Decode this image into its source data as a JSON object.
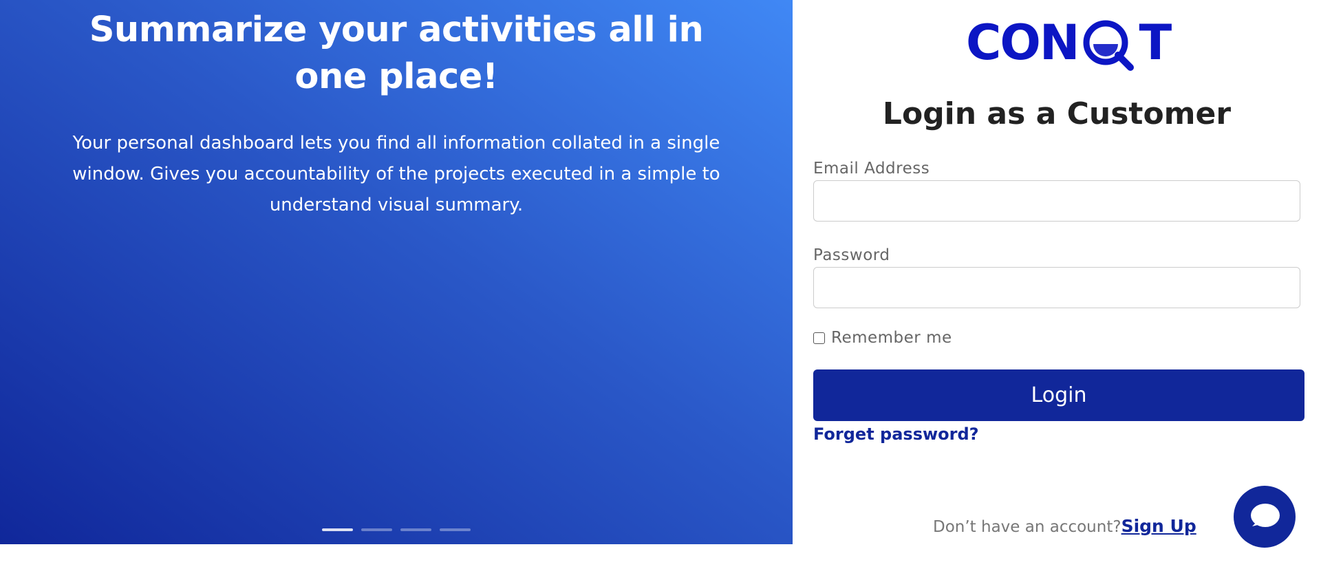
{
  "hero": {
    "title": "Summarize your activities all in one place!",
    "description": "Your personal dashboard lets you find all information collated in a single window. Gives you accountability of the projects executed in a simple to understand visual summary.",
    "carousel": {
      "slides": 4,
      "active_index": 0
    }
  },
  "brand": {
    "logo_left": "CON",
    "logo_right": "T",
    "logo_color": "#0c16c4"
  },
  "login": {
    "title": "Login as a Customer",
    "email_label": "Email Address",
    "email_value": "",
    "password_label": "Password",
    "password_value": "",
    "remember_label": "Remember me",
    "remember_checked": false,
    "submit_label": "Login",
    "forgot_label": "Forget password?",
    "signup_prompt": "Don’t have an account?",
    "signup_label": "Sign Up"
  },
  "colors": {
    "primary": "#11279a",
    "hero_gradient_start": "#10279a",
    "hero_gradient_end": "#4088f5"
  },
  "chat": {
    "icon": "chat-bubble-icon"
  }
}
